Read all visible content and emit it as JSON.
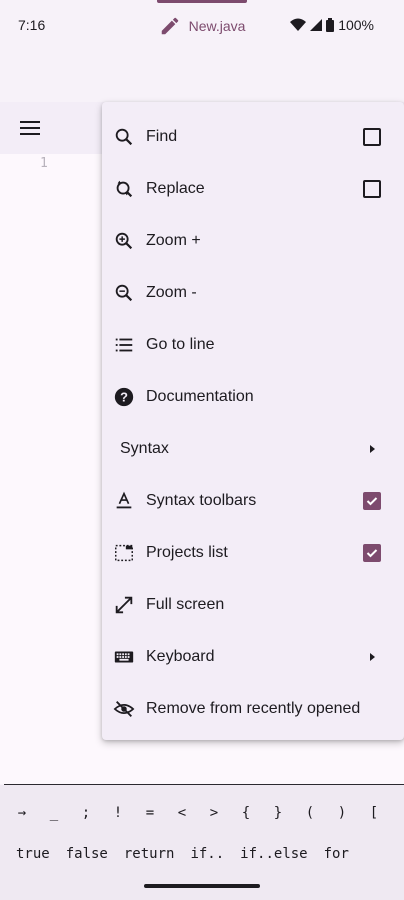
{
  "status_bar": {
    "time": "7:16",
    "battery": "100%"
  },
  "tab": {
    "label": "New.java",
    "icon": "pencil-icon"
  },
  "editor": {
    "line_numbers": [
      "1"
    ]
  },
  "menu": {
    "items": [
      {
        "label": "Find",
        "icon": "search-icon",
        "trailing": "checkbox",
        "checked": false
      },
      {
        "label": "Replace",
        "icon": "replace-icon",
        "trailing": "checkbox",
        "checked": false
      },
      {
        "label": "Zoom +",
        "icon": "zoom-in-icon"
      },
      {
        "label": "Zoom -",
        "icon": "zoom-out-icon"
      },
      {
        "label": "Go to line",
        "icon": "list-icon"
      },
      {
        "label": "Documentation",
        "icon": "help-icon"
      },
      {
        "label": "Syntax",
        "trailing": "submenu"
      },
      {
        "label": "Syntax toolbars",
        "icon": "text-format-icon",
        "trailing": "checkbox",
        "checked": true
      },
      {
        "label": "Projects list",
        "icon": "projects-list-icon",
        "trailing": "checkbox",
        "checked": true
      },
      {
        "label": "Full screen",
        "icon": "fullscreen-icon"
      },
      {
        "label": "Keyboard",
        "icon": "keyboard-icon",
        "trailing": "submenu"
      },
      {
        "label": "Remove from recently opened",
        "icon": "visibility-off-icon"
      }
    ]
  },
  "symbols": [
    "→",
    "_",
    ";",
    "!",
    "=",
    "<",
    ">",
    "{",
    "}",
    "(",
    ")",
    "["
  ],
  "snippets": [
    "true",
    "false",
    "return",
    "if..",
    "if..else",
    "for"
  ],
  "colors": {
    "accent": "#7d4b6e",
    "menu_bg": "#f3edf7",
    "editor_bg": "#fdf8fd"
  }
}
